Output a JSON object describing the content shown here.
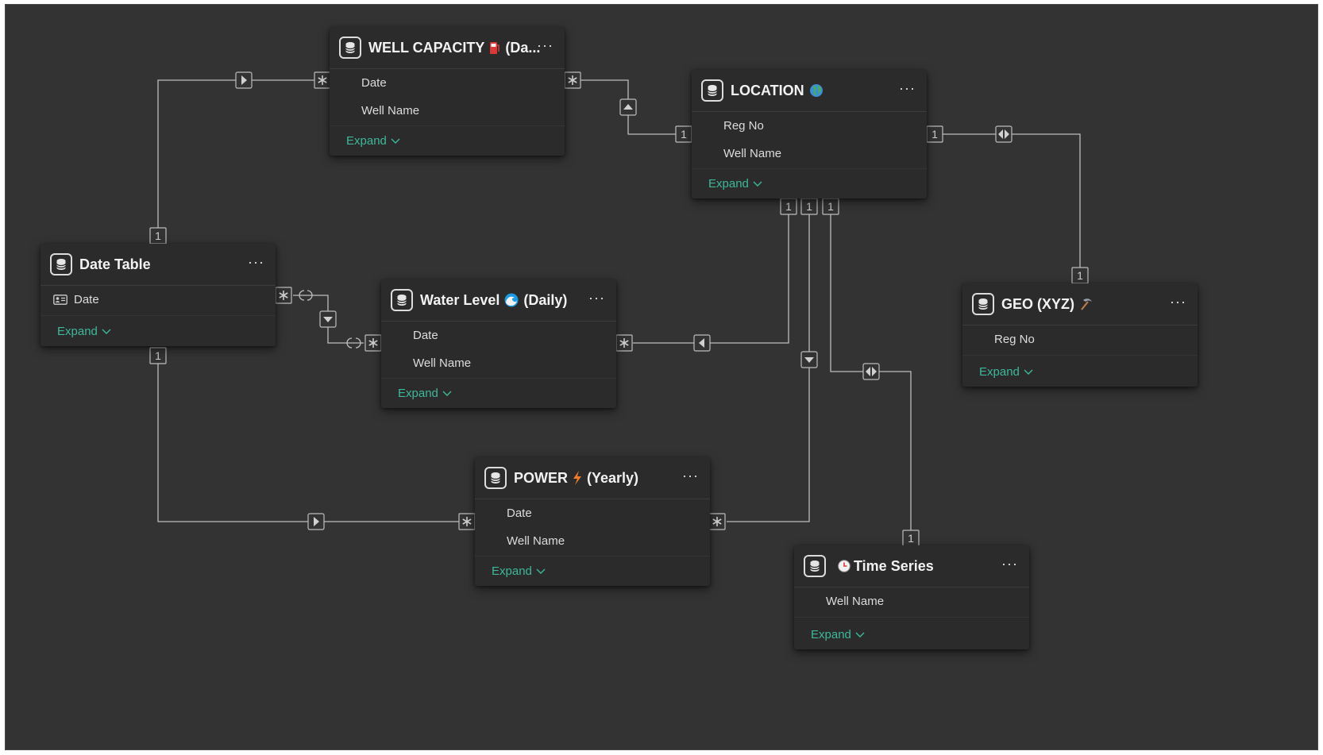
{
  "tables": {
    "well_capacity": {
      "title": "WELL CAPACITY",
      "title_suffix": "(Da...",
      "emoji": "fuel-pump",
      "fields": [
        "Date",
        "Well Name"
      ],
      "expand": "Expand"
    },
    "location": {
      "title": "LOCATION",
      "emoji": "globe",
      "fields": [
        "Reg No",
        "Well Name"
      ],
      "expand": "Expand"
    },
    "date_table": {
      "title": "Date Table",
      "fields": [
        "Date"
      ],
      "expand": "Expand"
    },
    "water_level": {
      "title": "Water Level",
      "title_suffix": "(Daily)",
      "emoji": "wave",
      "fields": [
        "Date",
        "Well Name"
      ],
      "expand": "Expand"
    },
    "geo": {
      "title": "GEO (XYZ)",
      "emoji": "pick",
      "fields": [
        "Reg No"
      ],
      "expand": "Expand"
    },
    "power": {
      "title": "POWER",
      "title_suffix": "(Yearly)",
      "emoji": "lightning",
      "fields": [
        "Date",
        "Well Name"
      ],
      "expand": "Expand"
    },
    "time_series": {
      "title": "Time Series",
      "emoji": "clock",
      "fields": [
        "Well Name"
      ],
      "expand": "Expand"
    }
  },
  "relationships": [
    {
      "from": "Date Table",
      "from_cardinality": "1",
      "to": "WELL CAPACITY",
      "to_cardinality": "*",
      "direction": "single"
    },
    {
      "from": "LOCATION",
      "from_cardinality": "1",
      "to": "WELL CAPACITY",
      "to_cardinality": "*",
      "direction": "single"
    },
    {
      "from": "LOCATION",
      "from_cardinality": "1",
      "to": "GEO (XYZ)",
      "to_cardinality": "1",
      "direction": "both"
    },
    {
      "from": "Date Table",
      "from_cardinality": "*",
      "to": "Water Level (Daily)",
      "to_cardinality": "*",
      "direction": "single"
    },
    {
      "from": "LOCATION",
      "from_cardinality": "1",
      "to": "Water Level (Daily)",
      "to_cardinality": "*",
      "direction": "single"
    },
    {
      "from": "LOCATION",
      "from_cardinality": "1",
      "to": "POWER (Yearly)",
      "to_cardinality": "*",
      "direction": "single"
    },
    {
      "from": "LOCATION",
      "from_cardinality": "1",
      "to": "Time Series",
      "to_cardinality": "1",
      "direction": "both"
    },
    {
      "from": "Date Table",
      "from_cardinality": "1",
      "to": "POWER (Yearly)",
      "to_cardinality": "*",
      "direction": "single"
    }
  ],
  "markers": {
    "one": "1",
    "many": "*"
  },
  "colors": {
    "canvas": "#333333",
    "card": "#2b2b2b",
    "line": "#bdbdbd",
    "accent": "#3eb89a"
  }
}
